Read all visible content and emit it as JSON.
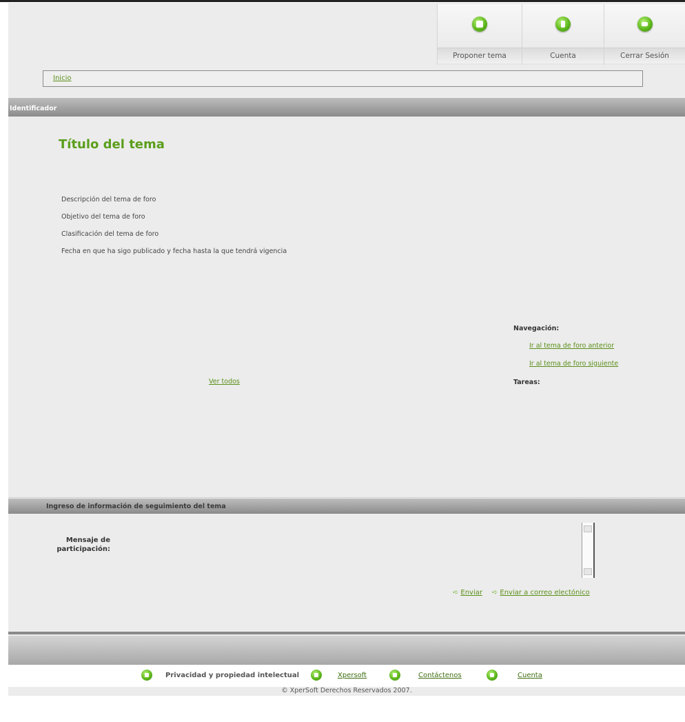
{
  "header": {
    "nav": [
      {
        "label": "Proponer tema",
        "icon": "mail-icon"
      },
      {
        "label": "Cuenta",
        "icon": "document-icon"
      },
      {
        "label": "Cerrar Sesión",
        "icon": "exit-arrow-icon"
      }
    ]
  },
  "breadcrumb": {
    "home": "Inicio"
  },
  "section": {
    "identifier": "Identificador"
  },
  "topic": {
    "title": "Título del tema",
    "lines": [
      "Descripción del tema de foro",
      "Objetivo del tema de foro",
      "Clasificación del tema de foro",
      "Fecha en que ha sigo publicado y fecha hasta la que tendrá vigencia"
    ],
    "view_all": "Ver todos"
  },
  "navigation": {
    "heading": "Navegación:",
    "prev": "Ir al tema de foro anterior",
    "next": "Ir al tema de foro siguiente",
    "tasks": "Tareas:"
  },
  "followup": {
    "heading": "Ingreso de información de seguimiento del tema",
    "message_label": "Mensaje de participación:",
    "send": "Enviar",
    "send_email": "Enviar a correo electónico"
  },
  "footer": {
    "links": [
      {
        "label": "Privacidad y propiedad intelectual",
        "icon": "lock-icon"
      },
      {
        "label": "Xpersoft",
        "icon": "lock-icon"
      },
      {
        "label": "Contáctenos",
        "icon": "lock-icon"
      },
      {
        "label": "Cuenta",
        "icon": "lock-icon"
      }
    ],
    "copyright": "© XperSoft Derechos Reservados 2007."
  },
  "colors": {
    "accent": "#5a9e1a",
    "link": "#5a8f18",
    "bar": "#8b8b8b",
    "background": "#ececec"
  }
}
